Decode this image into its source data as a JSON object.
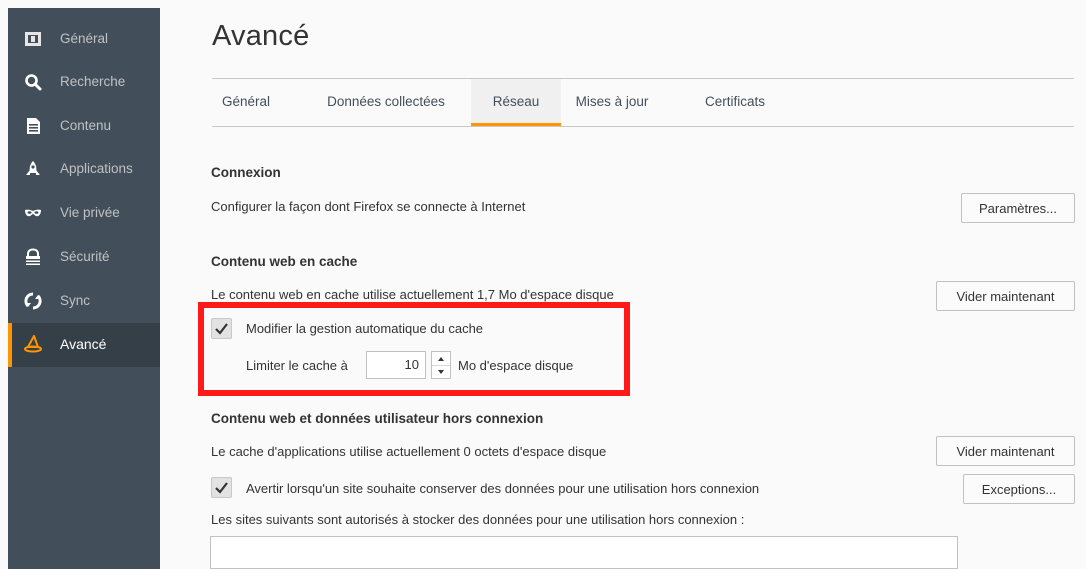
{
  "sidebar": {
    "items": [
      {
        "label": "Général",
        "icon": "general-icon"
      },
      {
        "label": "Recherche",
        "icon": "search-icon"
      },
      {
        "label": "Contenu",
        "icon": "content-icon"
      },
      {
        "label": "Applications",
        "icon": "rocket-icon"
      },
      {
        "label": "Vie privée",
        "icon": "mask-icon"
      },
      {
        "label": "Sécurité",
        "icon": "lock-icon"
      },
      {
        "label": "Sync",
        "icon": "sync-icon"
      },
      {
        "label": "Avancé",
        "icon": "wizard-hat-icon"
      }
    ],
    "active_index": 7
  },
  "page": {
    "title": "Avancé"
  },
  "tabs": [
    {
      "label": "Général"
    },
    {
      "label": "Données collectées"
    },
    {
      "label": "Réseau"
    },
    {
      "label": "Mises à jour"
    },
    {
      "label": "Certificats"
    }
  ],
  "active_tab_index": 2,
  "connexion": {
    "heading": "Connexion",
    "description": "Configurer la façon dont Firefox se connecte à Internet",
    "button": "Paramètres..."
  },
  "cache": {
    "heading": "Contenu web en cache",
    "description": "Le contenu web en cache utilise actuellement 1,7 Mo d'espace disque",
    "button": "Vider maintenant",
    "override_label": "Modifier la gestion automatique du cache",
    "override_checked": true,
    "limit_prefix": "Limiter le cache à",
    "limit_value": "10",
    "limit_suffix": "Mo d'espace disque"
  },
  "offline": {
    "heading": "Contenu web et données utilisateur hors connexion",
    "description": "Le cache d'applications utilise actuellement 0 octets d'espace disque",
    "button": "Vider maintenant",
    "warn_label": "Avertir lorsqu'un site souhaite conserver des données pour une utilisation hors connexion",
    "warn_checked": true,
    "exceptions_button": "Exceptions...",
    "allowed_sites_label": "Les sites suivants sont autorisés à stocker des données pour une utilisation hors connexion :"
  },
  "colors": {
    "sidebar_bg": "#424f5a",
    "accent": "#ff9500",
    "highlight": "#ff1a1a"
  }
}
